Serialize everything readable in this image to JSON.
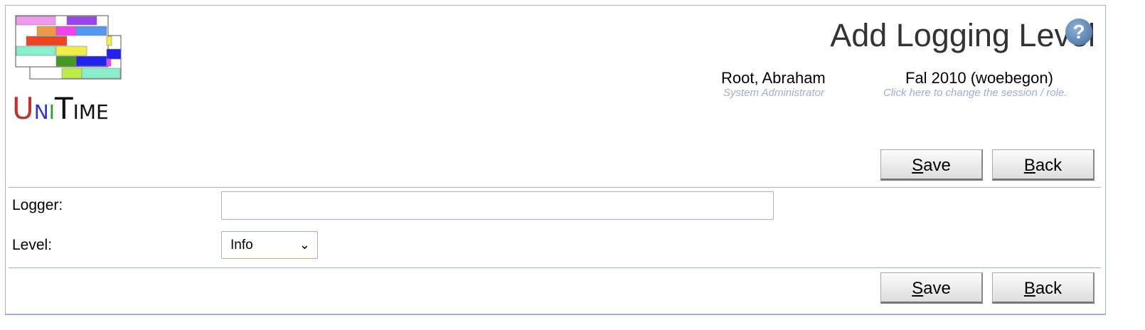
{
  "header": {
    "title": "Add Logging Level",
    "user_name": "Root, Abraham",
    "user_role": "System Administrator",
    "session": "Fal 2010 (woebegon)",
    "session_hint": "Click here to change the session / role.",
    "logo_text": "UniTime"
  },
  "buttons": {
    "save_label": "Save",
    "save_mnemonic": "S",
    "save_rest": "ave",
    "back_label": "Back",
    "back_mnemonic": "B",
    "back_rest": "ack"
  },
  "form": {
    "logger_label": "Logger:",
    "logger_value": "",
    "level_label": "Level:",
    "level_value": "Info"
  },
  "colors": {
    "border": "#9cb0d8",
    "hint": "#9cb0d8"
  }
}
